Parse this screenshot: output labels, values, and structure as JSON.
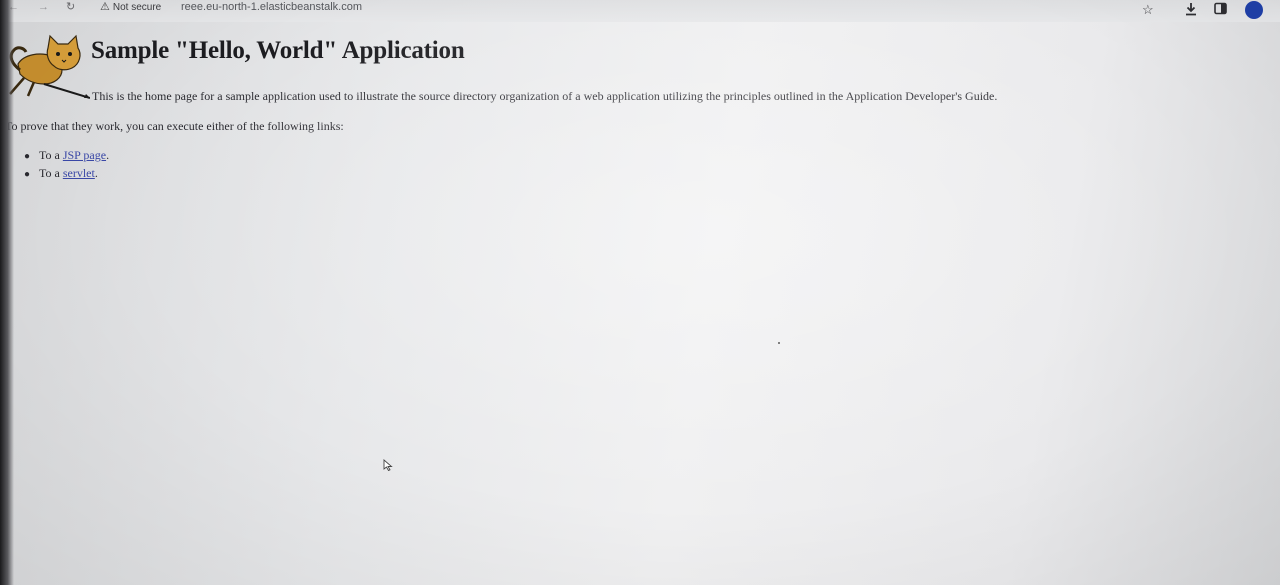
{
  "browser": {
    "security_label": "Not secure",
    "url": "reee.eu-north-1.elasticbeanstalk.com"
  },
  "page": {
    "title": "Sample \"Hello, World\" Application",
    "intro": "This is the home page for a sample application used to illustrate the source directory organization of a web application utilizing the principles outlined in the Application Developer's Guide.",
    "prove_text": "To prove that they work, you can execute either of the following links:",
    "links": [
      {
        "prefix": "To a ",
        "link_text": "JSP page",
        "suffix": "."
      },
      {
        "prefix": "To a ",
        "link_text": "servlet",
        "suffix": "."
      }
    ]
  },
  "icons": {
    "back": "back-arrow-icon",
    "forward": "forward-arrow-icon",
    "reload": "reload-icon",
    "warning": "warning-triangle-icon",
    "star": "bookmark-star-icon",
    "download": "download-icon",
    "sidebar": "side-panel-icon",
    "profile": "profile-avatar-icon",
    "logo": "tomcat-logo-icon"
  },
  "colors": {
    "link": "#3a48a8",
    "profile": "#1f3fa8",
    "title": "#1c1c20"
  }
}
